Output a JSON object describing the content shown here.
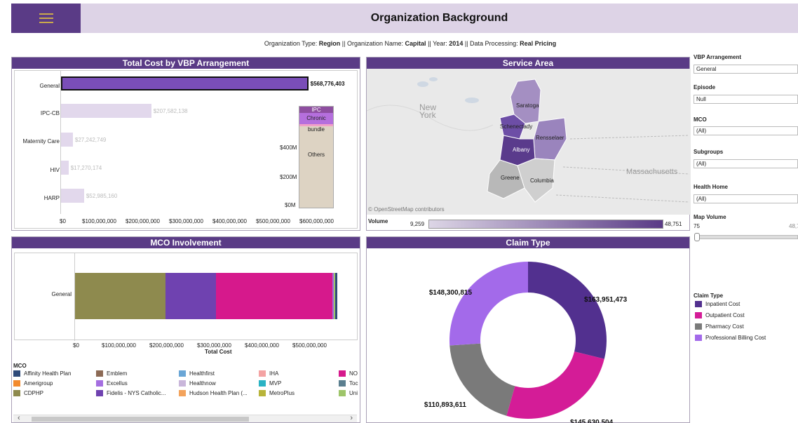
{
  "header": {
    "title": "Organization Background",
    "menu_icon": "hamburger-menu-icon"
  },
  "subtitle": {
    "type_label": "Organization Type:",
    "type_value": "Region",
    "sep1": "||",
    "name_label": "Organization Name:",
    "name_value": "Capital",
    "sep2": "||",
    "year_label": "Year:",
    "year_value": "2014",
    "sep3": "||",
    "proc_label": "Data Processing:",
    "proc_value": "Real Pricing"
  },
  "total_cost": {
    "title": "Total Cost by VBP Arrangement",
    "rows": [
      {
        "label": "General",
        "value_label": "$568,776,403"
      },
      {
        "label": "IPC-CB",
        "value_label": "$207,582,138"
      },
      {
        "label": "Maternity Care",
        "value_label": "$27,242,749"
      },
      {
        "label": "HIV",
        "value_label": "$17,270,174"
      },
      {
        "label": "HARP",
        "value_label": "$52,985,160"
      }
    ],
    "x_ticks": [
      "$0",
      "$100,000,000",
      "$200,000,000",
      "$300,000,000",
      "$400,000,000",
      "$500,000,000",
      "$600,000,000"
    ],
    "stack_ticks": [
      "$400M",
      "$200M",
      "$0M"
    ],
    "stack_labels": {
      "ipc": "IPC",
      "chronic": "Chronic bundle",
      "others": "Others"
    }
  },
  "service_area": {
    "title": "Service Area",
    "labels": {
      "new_york": "New\nYork",
      "saratoga": "Saratoga",
      "schenectady": "Schenectady",
      "rensselaer": "Rensselaer",
      "albany": "Albany",
      "greene": "Greene",
      "columbia": "Columbia",
      "massachusetts": "Massachusetts"
    },
    "attribution": "© OpenStreetMap contributors",
    "volume_label": "Volume",
    "volume_min": "9,259",
    "volume_max": "48,751"
  },
  "filters": {
    "vbp_label": "VBP Arrangement",
    "vbp_value": "General",
    "episode_label": "Episode",
    "episode_value": "Null",
    "mco_label": "MCO",
    "mco_value": "(All)",
    "subgroups_label": "Subgroups",
    "subgroups_value": "(All)",
    "health_home_label": "Health Home",
    "health_home_value": "(All)",
    "map_volume_label": "Map Volume",
    "map_volume_min": "75",
    "map_volume_max": "48,7"
  },
  "mco": {
    "title": "MCO Involvement",
    "row_label": "General",
    "x_ticks": [
      "$0",
      "$100,000,000",
      "$200,000,000",
      "$300,000,000",
      "$400,000,000",
      "$500,000,000"
    ],
    "x_title": "Total Cost",
    "legend_title": "MCO",
    "legend": [
      {
        "name": "Affinity Health Plan",
        "color": "#2e4a7a"
      },
      {
        "name": "Emblem",
        "color": "#8c6a55"
      },
      {
        "name": "Healthfirst",
        "color": "#6aa6d6"
      },
      {
        "name": "IHA",
        "color": "#f4a3a3"
      },
      {
        "name": "NO",
        "color": "#d6198c"
      },
      {
        "name": "Amerigroup",
        "color": "#f28a2e"
      },
      {
        "name": "Excellus",
        "color": "#a46ee0"
      },
      {
        "name": "Healthnow",
        "color": "#c9b6da"
      },
      {
        "name": "MVP",
        "color": "#2ab3c4"
      },
      {
        "name": "Toc",
        "color": "#5b7f8f"
      },
      {
        "name": "CDPHP",
        "color": "#8e8a4e"
      },
      {
        "name": "Fidelis - NYS Catholic...",
        "color": "#6f42b0"
      },
      {
        "name": "Hudson Health Plan (...",
        "color": "#f3a35c"
      },
      {
        "name": "MetroPlus",
        "color": "#b8b43a"
      },
      {
        "name": "Uni",
        "color": "#9ec56a"
      }
    ]
  },
  "claim_type": {
    "title": "Claim Type",
    "legend_title": "Claim Type",
    "legend": [
      {
        "name": "Inpatient Cost",
        "color": "#52308f"
      },
      {
        "name": "Outpatient Cost",
        "color": "#d41c97"
      },
      {
        "name": "Pharmacy Cost",
        "color": "#7a7a7a"
      },
      {
        "name": "Professional Billing Cost",
        "color": "#a36aea"
      }
    ]
  },
  "chart_data": [
    {
      "type": "bar",
      "title": "Total Cost by VBP Arrangement",
      "categories": [
        "General",
        "IPC-CB",
        "Maternity Care",
        "HIV",
        "HARP"
      ],
      "values": [
        568776403,
        207582138,
        27242749,
        17270174,
        52985160
      ],
      "xlim": [
        0,
        650000000
      ]
    },
    {
      "type": "bar",
      "categories": [
        "General"
      ],
      "series": [
        {
          "name": "CDPHP",
          "values": [
            190000000
          ]
        },
        {
          "name": "Fidelis - NYS Catholic...",
          "values": [
            105000000
          ]
        },
        {
          "name": "NO",
          "values": [
            245000000
          ]
        },
        {
          "name": "Excellus",
          "values": [
            2500000
          ]
        },
        {
          "name": "Uni",
          "values": [
            3000000
          ]
        },
        {
          "name": "Affinity Health Plan",
          "values": [
            5000000
          ]
        }
      ],
      "xlabel": "Total Cost",
      "xlim": [
        0,
        580000000
      ]
    },
    {
      "type": "pie",
      "title": "Claim Type",
      "categories": [
        "Inpatient Cost",
        "Outpatient Cost",
        "Pharmacy Cost",
        "Professional Billing Cost"
      ],
      "values": [
        163951473,
        145630504,
        110893611,
        148300815
      ],
      "value_labels": [
        "$163,951,473",
        "$145,630,504",
        "$110,893,611",
        "$148,300,815"
      ]
    }
  ]
}
